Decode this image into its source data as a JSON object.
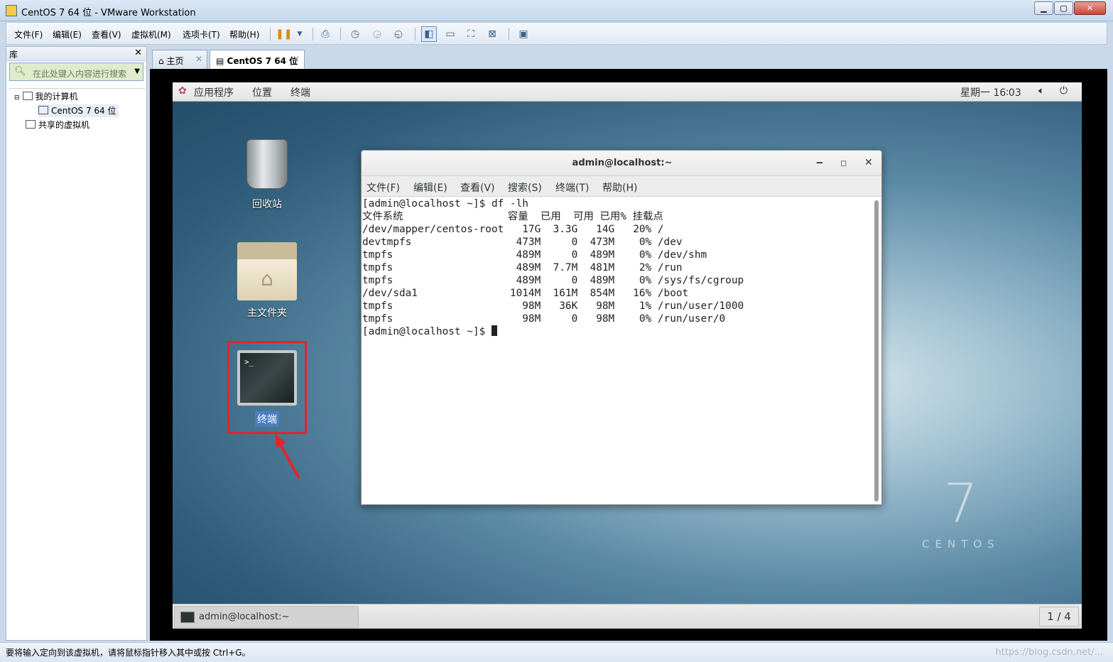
{
  "window": {
    "title": "CentOS 7 64 位 - VMware Workstation",
    "controls": [
      "minimize",
      "maximize",
      "close"
    ]
  },
  "menubar": {
    "items": [
      "文件(F)",
      "编辑(E)",
      "查看(V)",
      "虚拟机(M)",
      "选项卡(T)",
      "帮助(H)"
    ],
    "tool_icons": [
      "pause-icon",
      "dropdown-icon",
      "send-keys-icon",
      "snapshot-icon",
      "revert-snapshot-icon",
      "snapshot-manager-icon",
      "library-view-icon",
      "console-view-icon",
      "fullscreen-icon",
      "unity-icon",
      "thumbnail-icon"
    ]
  },
  "library": {
    "title": "库",
    "search_placeholder": "在此处键入内容进行搜索",
    "tree": [
      {
        "label": "我的计算机",
        "level": 0
      },
      {
        "label": "CentOS 7 64 位",
        "level": 1
      },
      {
        "label": "共享的虚拟机",
        "level": 0
      }
    ]
  },
  "tabs": [
    {
      "label": "主页",
      "icon": "home-icon"
    },
    {
      "label": "CentOS 7 64 位",
      "icon": "vm-icon",
      "active": true
    }
  ],
  "guest": {
    "topbar": {
      "apps": "应用程序",
      "places": "位置",
      "terminal": "终端",
      "clock": "星期一 16∶03"
    },
    "desktop_icons": [
      {
        "label": "回收站",
        "icon": "trash-icon"
      },
      {
        "label": "主文件夹",
        "icon": "home-folder-icon"
      },
      {
        "label": "终端",
        "icon": "terminal-icon",
        "selected": true
      }
    ],
    "brand": {
      "numeral": "7",
      "word": "CENTOS"
    },
    "terminal_window": {
      "title": "admin@localhost:~",
      "menu": [
        "文件(F)",
        "编辑(E)",
        "查看(V)",
        "搜索(S)",
        "终端(T)",
        "帮助(H)"
      ],
      "lines": [
        "[admin@localhost ~]$ df -lh",
        "文件系统                 容量  已用  可用 已用% 挂载点",
        "/dev/mapper/centos-root   17G  3.3G   14G   20% /",
        "devtmpfs                 473M     0  473M    0% /dev",
        "tmpfs                    489M     0  489M    0% /dev/shm",
        "tmpfs                    489M  7.7M  481M    2% /run",
        "tmpfs                    489M     0  489M    0% /sys/fs/cgroup",
        "/dev/sda1               1014M  161M  854M   16% /boot",
        "tmpfs                     98M   36K   98M    1% /run/user/1000",
        "tmpfs                     98M     0   98M    0% /run/user/0"
      ],
      "prompt": "[admin@localhost ~]$ "
    },
    "bottombar": {
      "task": "admin@localhost:~",
      "workspace": "1 / 4"
    }
  },
  "statusbar": {
    "message": "要将输入定向到该虚拟机，请将鼠标指针移入其中或按 Ctrl+G。",
    "watermark": "https://blog.csdn.net/..."
  },
  "colors": {
    "highlight_box": "#e0262c",
    "selected_label": "#4a7fc0",
    "chrome": "#dce8f5"
  }
}
